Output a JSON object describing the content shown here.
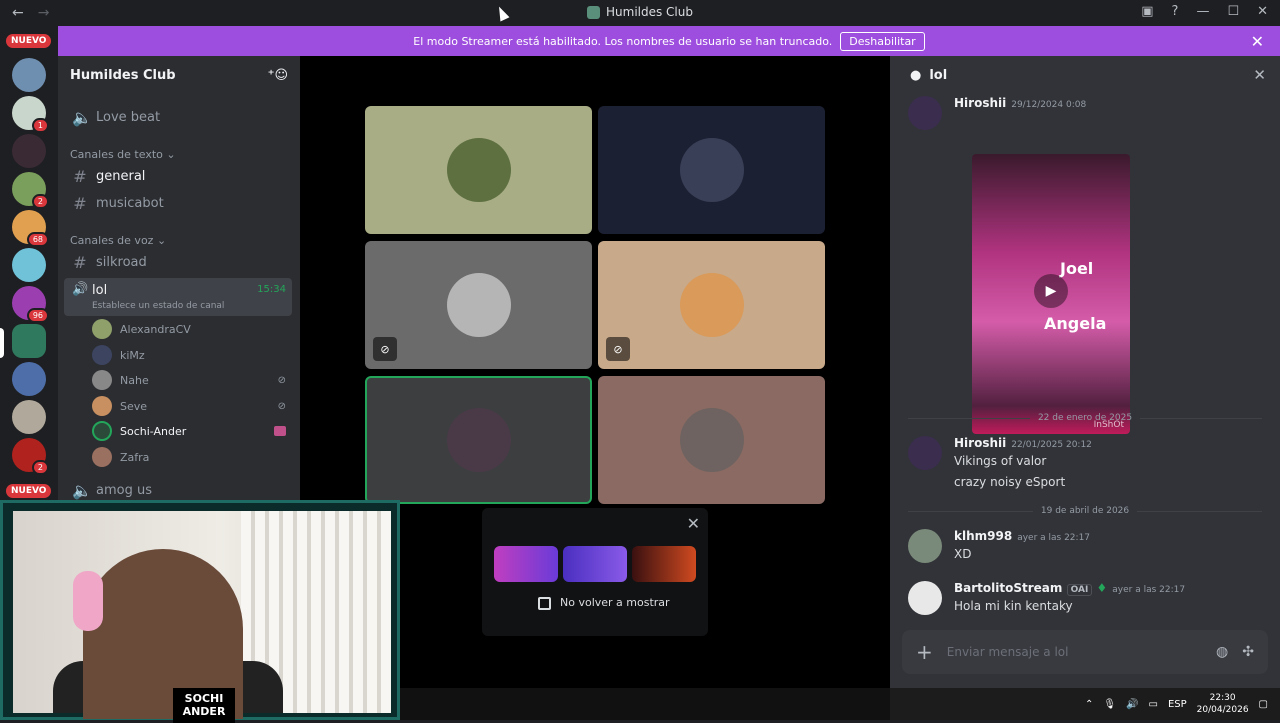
{
  "window": {
    "title": "Humildes Club"
  },
  "banner": {
    "text": "El modo Streamer está habilitado. Los nombres de usuario se han truncado.",
    "button": "Deshabilitar"
  },
  "servers": {
    "nuevo_top": "NUEVO",
    "nuevo_bottom": "NUEVO",
    "badges": [
      "1",
      "2",
      "68",
      "96",
      "2"
    ]
  },
  "guild": {
    "name": "Humildes Club"
  },
  "channels": {
    "love_beat": "Love beat",
    "text_category": "Canales de texto",
    "general": "general",
    "musicabot": "musicabot",
    "voice_category": "Canales de voz",
    "silkroad": "silkroad",
    "lol": "lol",
    "lol_time": "15:34",
    "lol_status": "Establece un estado de canal",
    "amog": "amog us",
    "voice_users": [
      "AlexandraCV",
      "kiMz",
      "Nahe",
      "Seve",
      "Sochi-Ander",
      "Zafra"
    ]
  },
  "popup": {
    "checkbox_label": "No volver a mostrar"
  },
  "chat": {
    "channel": "lol",
    "messages": [
      {
        "author": "Hiroshii",
        "time": "29/12/2024 0:08",
        "video_text1": "Joel",
        "video_text2": "Angela",
        "watermark": "InShOt"
      },
      {
        "divider": "22 de enero de 2025"
      },
      {
        "author": "Hiroshii",
        "time": "22/01/2025 20:12",
        "lines": [
          "Vikings of valor",
          "crazy noisy eSport"
        ]
      },
      {
        "divider": "19 de abril de 2026"
      },
      {
        "author": "klhm998",
        "time": "ayer a las 22:17",
        "lines": [
          "XD"
        ]
      },
      {
        "author": "BartolitoStream",
        "tag": "OAI",
        "time": "ayer a las 22:17",
        "lines": [
          "Hola mi kin kentaky"
        ]
      }
    ],
    "placeholder": "Enviar mensaje a lol"
  },
  "taskbar": {
    "lang": "ESP",
    "time": "22:30",
    "date": "20/04/2026"
  },
  "webcam": {
    "brand_top": "SOCHI",
    "brand_bottom": "ANDER"
  }
}
